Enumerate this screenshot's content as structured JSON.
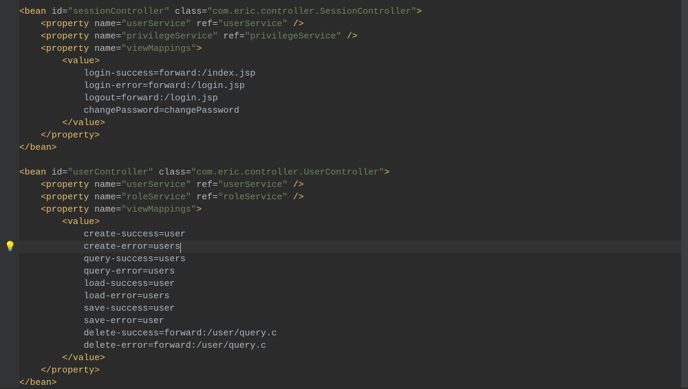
{
  "bean1": {
    "open": "<bean ",
    "idAttr": "id=",
    "idVal": "\"sessionController\"",
    "classAttr": " class=",
    "classVal": "\"com.eric.controller.SessionController\"",
    "close": ">"
  },
  "p1": {
    "open": "<property ",
    "nameAttr": "name=",
    "nameVal": "\"userService\"",
    "refAttr": " ref=",
    "refVal": "\"userService\"",
    "close": " />"
  },
  "p2": {
    "open": "<property ",
    "nameAttr": "name=",
    "nameVal": "\"privilegeService\"",
    "refAttr": " ref=",
    "refVal": "\"privilegeService\"",
    "close": " />"
  },
  "p3": {
    "open": "<property ",
    "nameAttr": "name=",
    "nameVal": "\"viewMappings\"",
    "close": ">"
  },
  "v1open": "<value>",
  "vm1": "            login-success=forward:/index.jsp",
  "vm2": "            login-error=forward:/login.jsp",
  "vm3": "            logout=forward:/login.jsp",
  "vm4": "            changePassword=changePassword",
  "v1close": "</value>",
  "propClose": "</property>",
  "beanClose": "</bean>",
  "blank": "",
  "bean2": {
    "open": "<bean ",
    "idAttr": "id=",
    "idVal": "\"userController\"",
    "classAttr": " class=",
    "classVal": "\"com.eric.controller.UserController\"",
    "close": ">"
  },
  "p4": {
    "open": "<property ",
    "nameAttr": "name=",
    "nameVal": "\"userService\"",
    "refAttr": " ref=",
    "refVal": "\"userService\"",
    "close": " />"
  },
  "p5": {
    "open": "<property ",
    "nameAttr": "name=",
    "nameVal": "\"roleService\"",
    "refAttr": " ref=",
    "refVal": "\"roleService\"",
    "close": " />"
  },
  "p6": {
    "open": "<property ",
    "nameAttr": "name=",
    "nameVal": "\"viewMappings\"",
    "close": ">"
  },
  "um1": "            create-success=user",
  "um2a": "            create-error=user",
  "um2b": "s",
  "um3": "            query-success=users",
  "um4": "            query-error=users",
  "um5": "            load-success=user",
  "um6": "            load-error=users",
  "um7": "            save-success=user",
  "um8": "            save-error=user",
  "um9": "            delete-success=forward:/user/query.c",
  "um10": "            delete-error=forward:/user/query.c"
}
